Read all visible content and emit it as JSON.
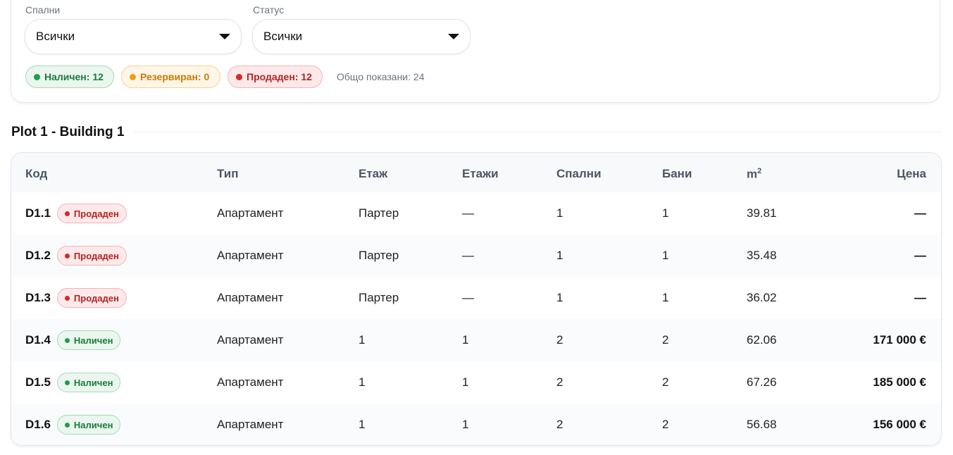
{
  "filters": {
    "bedrooms": {
      "label": "Спални",
      "value": "Всички"
    },
    "status": {
      "label": "Статус",
      "value": "Всички"
    },
    "chips": {
      "available": "Наличен: 12",
      "reserved": "Резервиран: 0",
      "sold": "Продаден: 12"
    },
    "total_shown": "Общо показани: 24"
  },
  "colors": {
    "available": "#1f9d4c",
    "reserved": "#f39c12",
    "sold": "#d62828"
  },
  "section": {
    "title": "Plot 1 - Building 1"
  },
  "table": {
    "headers": {
      "code": "Код",
      "type": "Тип",
      "floor": "Етаж",
      "floors": "Етажи",
      "bedrooms": "Спални",
      "bathrooms": "Бани",
      "area": "m",
      "area_sup": "2",
      "price": "Цена"
    },
    "rows": [
      {
        "code": "D1.1",
        "status": "Продаден",
        "type": "Апартамент",
        "floor": "Партер",
        "floors": "—",
        "bedrooms": "1",
        "bathrooms": "1",
        "area": "39.81",
        "price": "—"
      },
      {
        "code": "D1.2",
        "status": "Продаден",
        "type": "Апартамент",
        "floor": "Партер",
        "floors": "—",
        "bedrooms": "1",
        "bathrooms": "1",
        "area": "35.48",
        "price": "—"
      },
      {
        "code": "D1.3",
        "status": "Продаден",
        "type": "Апартамент",
        "floor": "Партер",
        "floors": "—",
        "bedrooms": "1",
        "bathrooms": "1",
        "area": "36.02",
        "price": "—"
      },
      {
        "code": "D1.4",
        "status": "Наличен",
        "type": "Апартамент",
        "floor": "1",
        "floors": "1",
        "bedrooms": "2",
        "bathrooms": "2",
        "area": "62.06",
        "price": "171 000 €"
      },
      {
        "code": "D1.5",
        "status": "Наличен",
        "type": "Апартамент",
        "floor": "1",
        "floors": "1",
        "bedrooms": "2",
        "bathrooms": "2",
        "area": "67.26",
        "price": "185 000 €"
      },
      {
        "code": "D1.6",
        "status": "Наличен",
        "type": "Апартамент",
        "floor": "1",
        "floors": "1",
        "bedrooms": "2",
        "bathrooms": "2",
        "area": "56.68",
        "price": "156 000 €"
      }
    ]
  }
}
